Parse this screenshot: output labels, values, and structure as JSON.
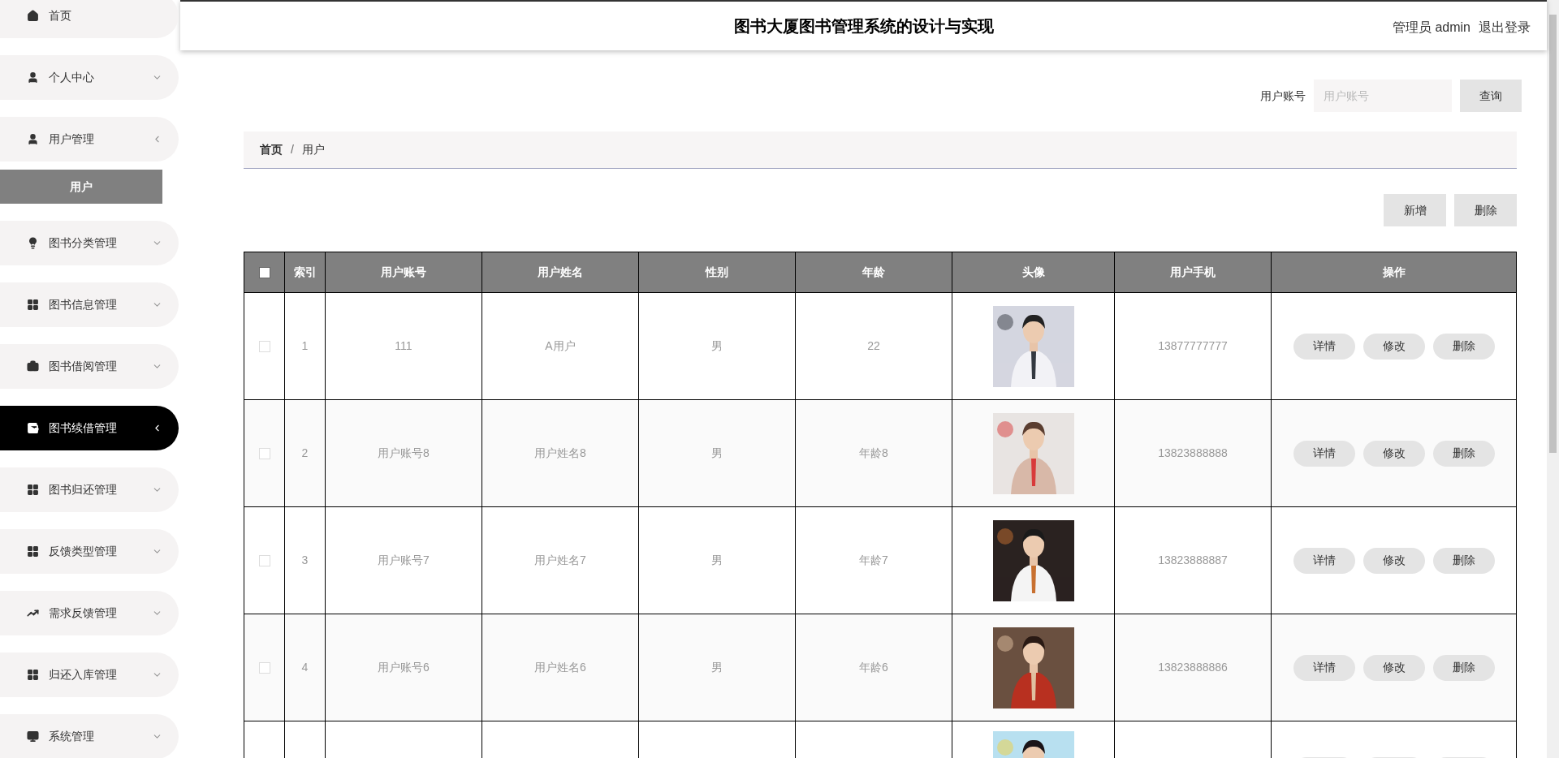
{
  "sidebar": {
    "items": [
      {
        "label": "首页",
        "selected": false,
        "kind": "link"
      },
      {
        "label": "个人中心",
        "expanded": false,
        "selected": false,
        "kind": "menu"
      },
      {
        "label": "用户管理",
        "expanded": true,
        "selected": false,
        "kind": "menu",
        "children": [
          {
            "label": "用户",
            "selected": true
          }
        ]
      },
      {
        "label": "图书分类管理",
        "expanded": false,
        "selected": false,
        "kind": "menu"
      },
      {
        "label": "图书信息管理",
        "expanded": false,
        "selected": false,
        "kind": "menu"
      },
      {
        "label": "图书借阅管理",
        "expanded": false,
        "selected": false,
        "kind": "menu"
      },
      {
        "label": "图书续借管理",
        "expanded": true,
        "selected": true,
        "kind": "menu"
      },
      {
        "label": "图书归还管理",
        "expanded": false,
        "selected": false,
        "kind": "menu"
      },
      {
        "label": "反馈类型管理",
        "expanded": false,
        "selected": false,
        "kind": "menu"
      },
      {
        "label": "需求反馈管理",
        "expanded": false,
        "selected": false,
        "kind": "menu"
      },
      {
        "label": "归还入库管理",
        "expanded": false,
        "selected": false,
        "kind": "menu"
      },
      {
        "label": "系统管理",
        "expanded": false,
        "selected": false,
        "kind": "menu"
      }
    ]
  },
  "header": {
    "title": "图书大厦图书管理系统的设计与实现",
    "user": "管理员 admin",
    "logout": "退出登录"
  },
  "search": {
    "label": "用户账号",
    "placeholder": "用户账号",
    "button": "查询"
  },
  "breadcrumb": {
    "items": [
      "首页",
      "用户"
    ],
    "separator": "/"
  },
  "toolbar": [
    "新增",
    "删除"
  ],
  "table": {
    "select_all": {
      "checked": false
    },
    "columns": [
      "索引",
      "用户账号",
      "用户姓名",
      "性别",
      "年龄",
      "头像",
      "用户手机",
      "操作"
    ],
    "rows": [
      {
        "kind": "full",
        "checked": false,
        "index": "1",
        "account": "111",
        "name": "A用户",
        "gender": "男",
        "age": "22",
        "phone": "13877777777",
        "actions": [
          "详情",
          "修改",
          "删除"
        ]
      },
      {
        "kind": "full",
        "checked": false,
        "index": "2",
        "account": "用户账号8",
        "name": "用户姓名8",
        "gender": "男",
        "age": "年龄8",
        "phone": "13823888888",
        "actions": [
          "详情",
          "修改",
          "删除"
        ]
      },
      {
        "kind": "full",
        "checked": false,
        "index": "3",
        "account": "用户账号7",
        "name": "用户姓名7",
        "gender": "男",
        "age": "年龄7",
        "phone": "13823888887",
        "actions": [
          "详情",
          "修改",
          "删除"
        ]
      },
      {
        "kind": "full",
        "checked": false,
        "index": "4",
        "account": "用户账号6",
        "name": "用户姓名6",
        "gender": "男",
        "age": "年龄6",
        "phone": "13823888886",
        "actions": [
          "详情",
          "修改",
          "删除"
        ]
      },
      {
        "kind": "partial"
      }
    ]
  }
}
